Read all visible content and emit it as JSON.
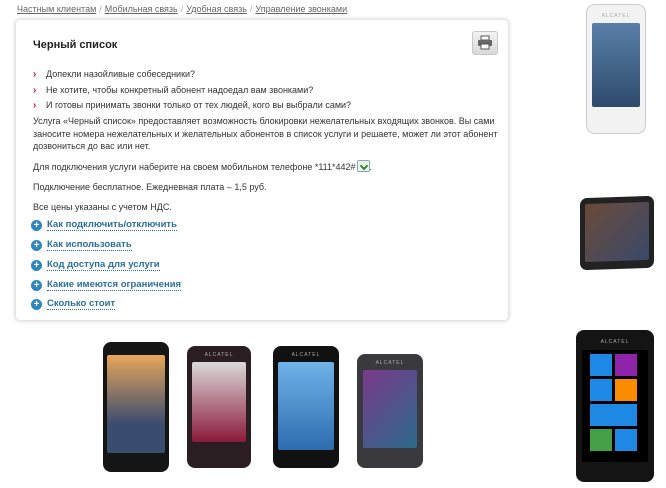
{
  "breadcrumb": {
    "items": [
      "Частным клиентам",
      "Мобильная связь",
      "Удобная связь",
      "Управление звонками"
    ],
    "separator": "/"
  },
  "card": {
    "title": "Черный список",
    "print_icon": "printer-icon",
    "questions": [
      "Допекли назойливые собеседники?",
      "Не хотите, чтобы конкретный абонент надоедал вам звонками?",
      "И готовы принимать звонки только от тех людей, кого вы выбрали сами?"
    ],
    "description": "Услуга «Черный список» предоставляет возможность блокировки нежелательных входящих звонков. Вы сами заносите номера нежелательных и желательных абонентов в список услуги и решаете, может ли этот абонент дозвониться до вас или нет.",
    "connect_text": "Для подключения услуги наберите на своем мобильном телефоне *111*442#",
    "price_text": "Подключение бесплатное. Ежедневная плата – 1,5 руб.",
    "vat_text": "Все цены указаны с учетом НДС.",
    "accordion": [
      "Как подключить/отключить",
      "Как использовать",
      "Код доступа для услуги",
      "Какие имеются ограничения",
      "Сколько стоит"
    ]
  },
  "devices": {
    "brand": "ALCATEL",
    "colors": {
      "accent_red": "#c8102e",
      "link_blue": "#2a6fa0",
      "plus_blue": "#2e86c1"
    }
  }
}
